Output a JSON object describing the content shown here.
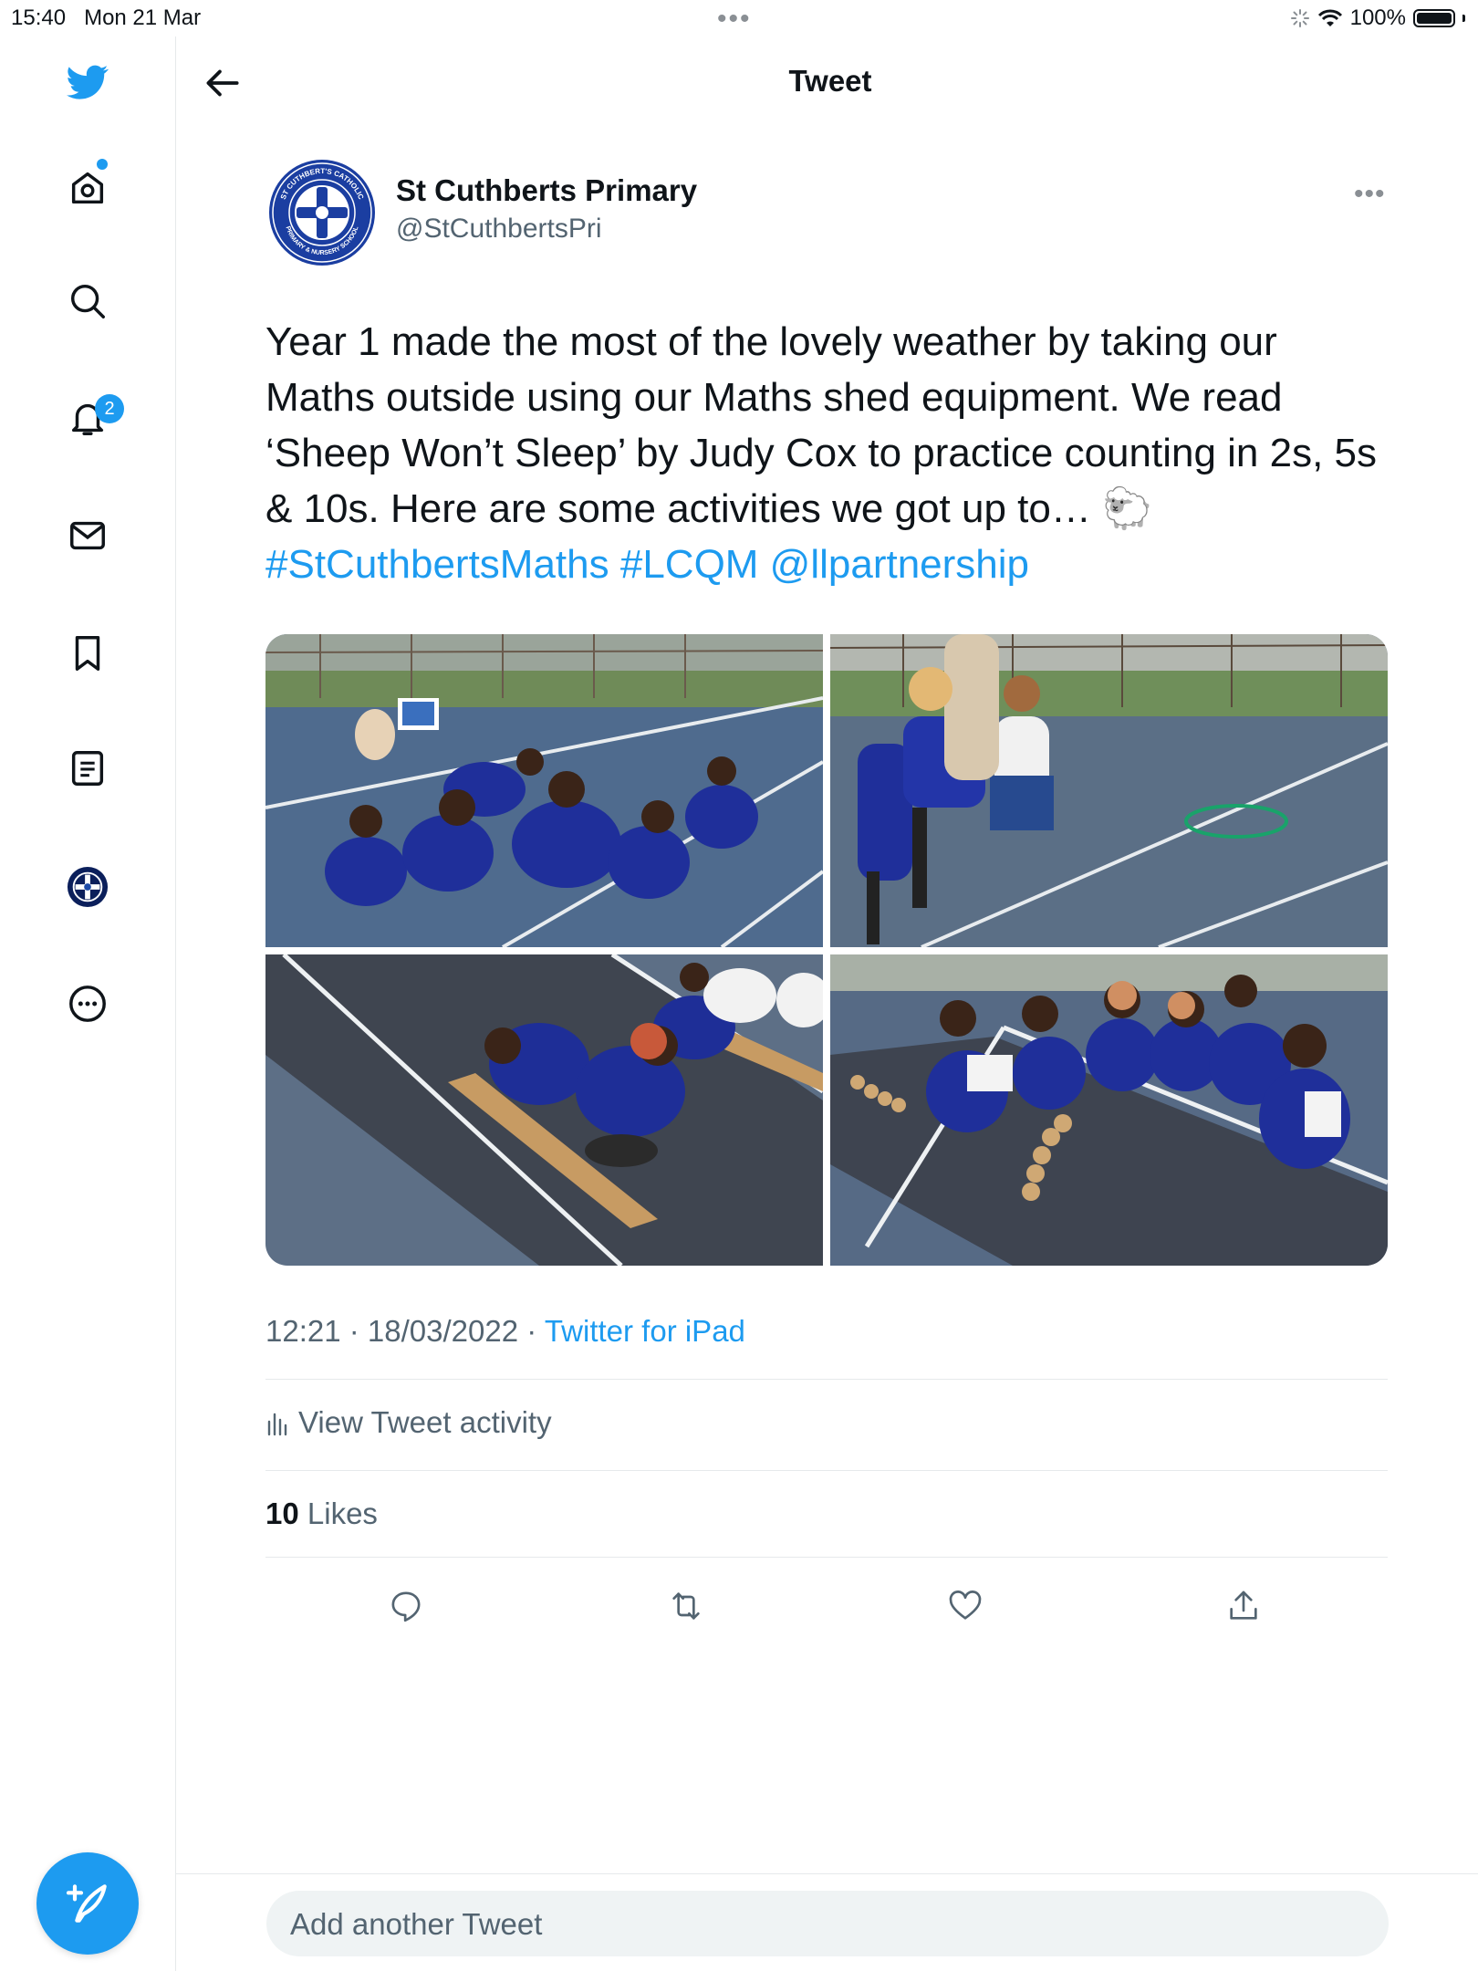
{
  "status_bar": {
    "time": "15:40",
    "date": "Mon 21 Mar",
    "battery": "100%"
  },
  "sidebar": {
    "notifications_badge": "2",
    "icons": [
      "twitter-bird-icon",
      "home-icon",
      "search-icon",
      "bell-icon",
      "mail-icon",
      "bookmark-icon",
      "list-icon",
      "profile-avatar",
      "more-icon"
    ]
  },
  "header": {
    "title": "Tweet"
  },
  "tweet": {
    "author_name": "St Cuthberts Primary",
    "author_handle": "@StCuthbertsPri",
    "avatar_text_top": "ST CUTHBERT'S CATHOLIC",
    "avatar_text_bottom": "PRIMARY & NURSERY SCHOOL",
    "text": "Year 1 made the most of the lovely weather by taking our Maths outside using our Maths shed equipment. We read ‘Sheep Won’t Sleep’ by Judy Cox to practice counting in 2s, 5s & 10s. Here are some activities we got up to… 🐑",
    "links": "#StCuthbertsMaths #LCQM @llpartnership",
    "photos": [
      "Teacher reading a book to children sitting on a playground",
      "Children in uniform with a hoop on the playground",
      "Children placing numbers on a wooden number line",
      "Children sitting behind wooden counters on the playground"
    ],
    "time": "12:21",
    "date": "18/03/2022",
    "source": "Twitter for iPad",
    "activity_label": "View Tweet activity",
    "likes_count": "10",
    "likes_label": "Likes"
  },
  "reply": {
    "placeholder": "Add another Tweet"
  },
  "colors": {
    "accent": "#1d9bf0",
    "text": "#0f1419",
    "muted": "#536471"
  }
}
